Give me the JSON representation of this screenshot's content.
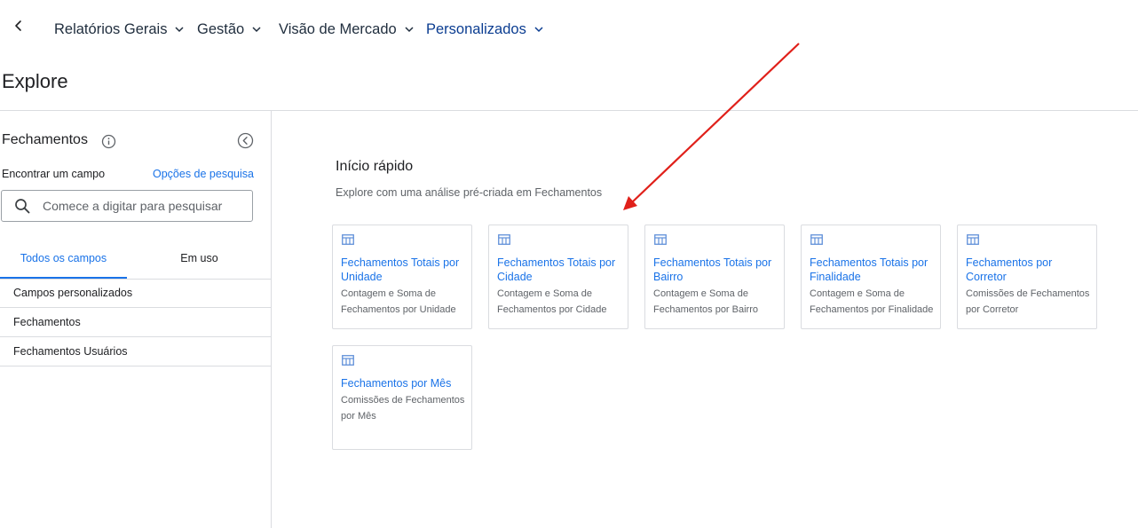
{
  "topnav": {
    "menus": [
      {
        "label": "Relatórios Gerais"
      },
      {
        "label": "Gestão"
      },
      {
        "label": "Visão de Mercado"
      },
      {
        "label": "Personalizados"
      }
    ]
  },
  "page": {
    "title": "Explore"
  },
  "sidebar": {
    "title": "Fechamentos",
    "find_label": "Encontrar um campo",
    "search_options": "Opções de pesquisa",
    "search_placeholder": "Comece a digitar para pesquisar",
    "search_value": "",
    "tabs": [
      {
        "label": "Todos os campos",
        "active": true
      },
      {
        "label": "Em uso",
        "active": false
      }
    ],
    "fields": [
      {
        "label": "Campos personalizados"
      },
      {
        "label": "Fechamentos"
      },
      {
        "label": "Fechamentos Usuários"
      }
    ]
  },
  "quickstart": {
    "title": "Início rápido",
    "subtitle": "Explore com uma análise pré-criada em Fechamentos",
    "cards": [
      {
        "title": "Fechamentos Totais por Unidade",
        "desc": "Contagem e Soma de Fechamentos por Unidade",
        "icon": "table-icon"
      },
      {
        "title": "Fechamentos Totais por Cidade",
        "desc": "Contagem e Soma de Fechamentos por Cidade",
        "icon": "table-icon"
      },
      {
        "title": "Fechamentos Totais por Bairro",
        "desc": "Contagem e Soma de Fechamentos por Bairro",
        "icon": "table-icon"
      },
      {
        "title": "Fechamentos Totais por Finalidade",
        "desc": "Contagem e Soma de Fechamentos por Finalidade",
        "icon": "table-icon"
      },
      {
        "title": "Fechamentos por Corretor",
        "desc": "Comissões de Fechamentos por Corretor",
        "icon": "table-icon"
      },
      {
        "title": "Fechamentos por Mês",
        "desc": "Comissões de Fechamentos por Mês",
        "icon": "table-icon"
      }
    ]
  },
  "colors": {
    "accent": "#1a73e8",
    "annotation_arrow": "#e0201a",
    "nav_text": "#1f2d3d",
    "active_nav": "#0b3d91"
  }
}
